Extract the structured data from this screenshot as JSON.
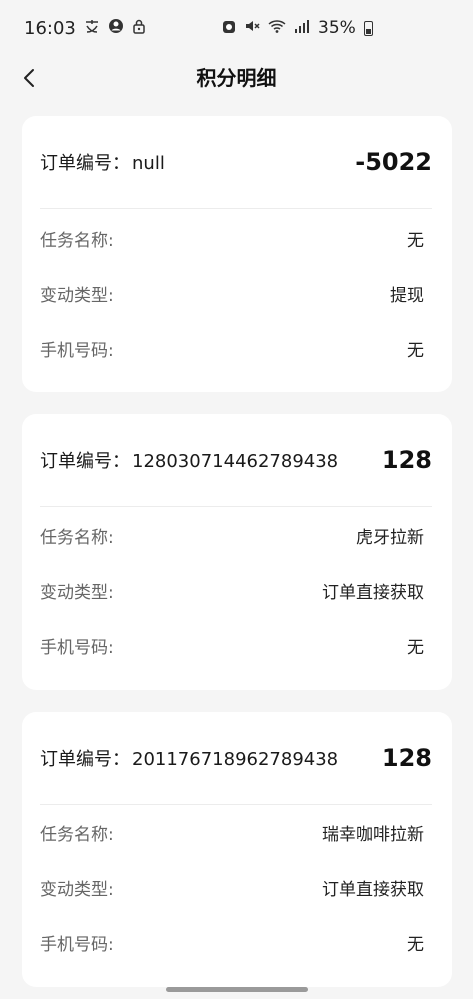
{
  "status_bar": {
    "time": "16:03",
    "battery": "35%"
  },
  "header": {
    "title": "积分明细"
  },
  "records": [
    {
      "order_label": "订单编号：",
      "order_id": "null",
      "points": "-5022",
      "task_label": "任务名称:",
      "task_value": "无",
      "type_label": "变动类型:",
      "type_value": "提现",
      "phone_label": "手机号码:",
      "phone_value": "无"
    },
    {
      "order_label": "订单编号：",
      "order_id": "128030714462789438",
      "points": "128",
      "task_label": "任务名称:",
      "task_value": "虎牙拉新",
      "type_label": "变动类型:",
      "type_value": "订单直接获取",
      "phone_label": "手机号码:",
      "phone_value": "无"
    },
    {
      "order_label": "订单编号：",
      "order_id": "201176718962789438",
      "points": "128",
      "task_label": "任务名称:",
      "task_value": "瑞幸咖啡拉新",
      "type_label": "变动类型:",
      "type_value": "订单直接获取",
      "phone_label": "手机号码:",
      "phone_value": "无"
    }
  ]
}
